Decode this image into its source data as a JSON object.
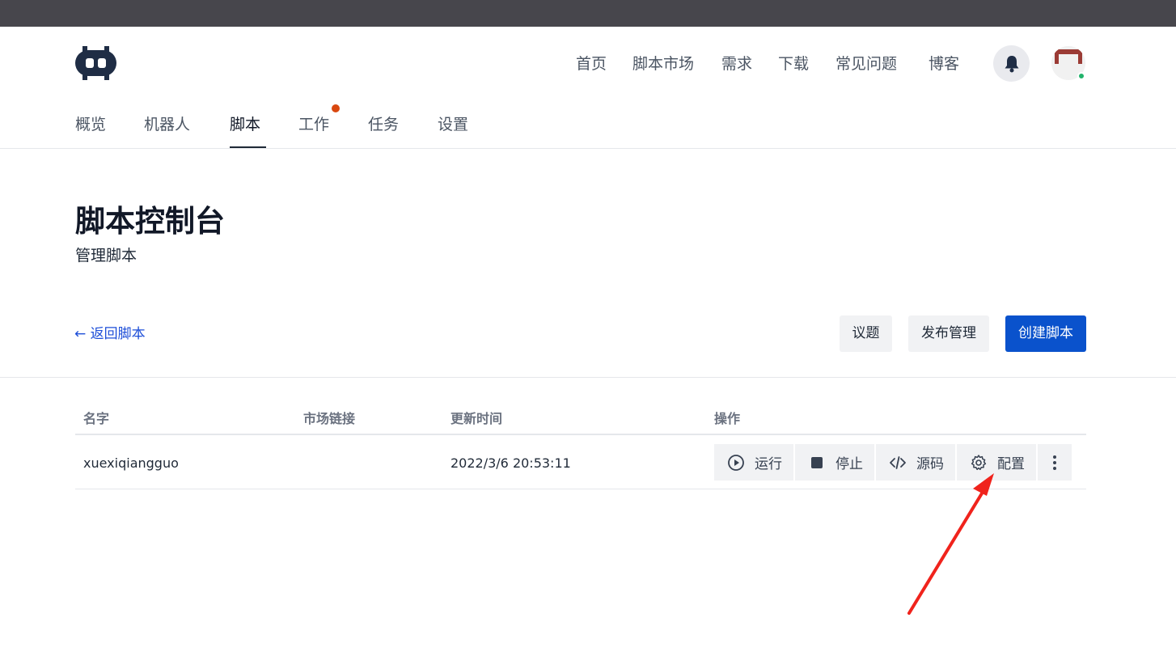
{
  "top_nav": {
    "items": [
      "首页",
      "脚本市场",
      "需求",
      "下载",
      "常见问题",
      "博客"
    ]
  },
  "icons": {
    "logo": "robot-logo-icon",
    "notifications": "bell-icon",
    "avatar": "user-avatar",
    "run": "play-circle-icon",
    "stop": "stop-square-icon",
    "source": "code-icon",
    "config": "gear-icon",
    "more": "vertical-dots-icon"
  },
  "sub_nav": {
    "items": [
      "概览",
      "机器人",
      "脚本",
      "工作",
      "任务",
      "设置"
    ],
    "active": "脚本",
    "notification_on": "工作"
  },
  "page": {
    "title": "脚本控制台",
    "subtitle": "管理脚本"
  },
  "toolbar": {
    "back_label": "← 返回脚本",
    "issues_label": "议题",
    "release_label": "发布管理",
    "create_label": "创建脚本"
  },
  "table": {
    "columns": [
      "名字",
      "市场链接",
      "更新时间",
      "操作"
    ],
    "rows": [
      {
        "name": "xuexiqiangguo",
        "market_link": "",
        "updated_at": "2022/3/6 20:53:11"
      }
    ],
    "row_actions": [
      "运行",
      "停止",
      "源码",
      "配置"
    ]
  },
  "colors": {
    "topbar": "#47464c",
    "primary": "#0a52cc",
    "link": "#1d4ed8",
    "notification_dot": "#d9480f",
    "online_dot": "#22b36b",
    "annotation_arrow": "#f0231c"
  }
}
